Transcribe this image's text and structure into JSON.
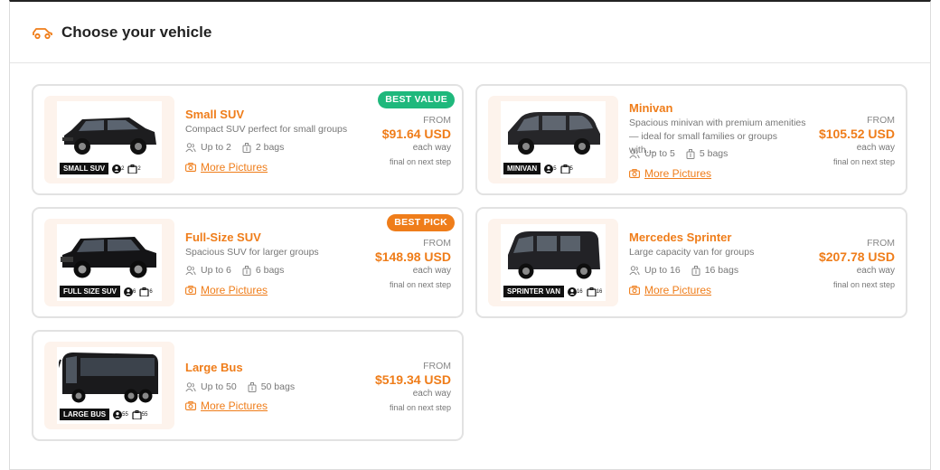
{
  "header": {
    "title": "Choose your vehicle"
  },
  "colors": {
    "accent": "#ef7d1a",
    "best_value": "#1fb87c",
    "best_pick": "#ef7d1a"
  },
  "price_labels": {
    "from": "FROM",
    "each_way": "each way",
    "final": "final on next step"
  },
  "more_label": "More Pictures",
  "vehicles": [
    {
      "name": "Small SUV",
      "desc": "Compact SUV perfect for small groups",
      "passengers": "Up to 2",
      "bags": "2 bags",
      "price": "$91.64 USD",
      "badge": "BEST VALUE",
      "badge_color": "#1fb87c",
      "thumb_label": "SMALL SUV",
      "thumb_pax": "2",
      "thumb_bags": "2",
      "icon": "suv-image"
    },
    {
      "name": "Minivan",
      "desc": "Spacious minivan with premium amenities — ideal for small families or groups with…",
      "passengers": "Up to 5",
      "bags": "5 bags",
      "price": "$105.52 USD",
      "badge": "",
      "badge_color": "",
      "thumb_label": "MINIVAN",
      "thumb_pax": "5",
      "thumb_bags": "5",
      "icon": "minivan-image"
    },
    {
      "name": "Full-Size SUV",
      "desc": "Spacious SUV for larger groups",
      "passengers": "Up to 6",
      "bags": "6 bags",
      "price": "$148.98 USD",
      "badge": "BEST PICK",
      "badge_color": "#ef7d1a",
      "thumb_label": "FULL SIZE SUV",
      "thumb_pax": "6",
      "thumb_bags": "6",
      "icon": "full-size-suv-image"
    },
    {
      "name": "Mercedes Sprinter",
      "desc": "Large capacity van for groups",
      "passengers": "Up to 16",
      "bags": "16 bags",
      "price": "$207.78 USD",
      "badge": "",
      "badge_color": "",
      "thumb_label": "SPRINTER VAN",
      "thumb_pax": "16",
      "thumb_bags": "16",
      "icon": "sprinter-van-image"
    },
    {
      "name": "Large Bus",
      "desc": "",
      "passengers": "Up to 50",
      "bags": "50 bags",
      "price": "$519.34 USD",
      "badge": "",
      "badge_color": "",
      "thumb_label": "LARGE BUS",
      "thumb_pax": "55",
      "thumb_bags": "55",
      "icon": "large-bus-image"
    }
  ]
}
